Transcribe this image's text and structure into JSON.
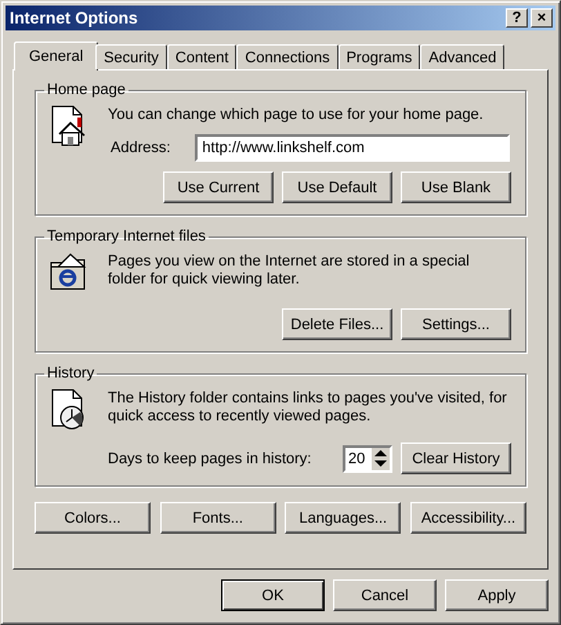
{
  "window": {
    "title": "Internet Options",
    "title_buttons": [
      "?",
      "×"
    ]
  },
  "tabs": [
    {
      "label": "General",
      "selected": true
    },
    {
      "label": "Security",
      "selected": false
    },
    {
      "label": "Content",
      "selected": false
    },
    {
      "label": "Connections",
      "selected": false
    },
    {
      "label": "Programs",
      "selected": false
    },
    {
      "label": "Advanced",
      "selected": false
    }
  ],
  "home_page": {
    "title": "Home page",
    "description": "You can change which page to use for your home page.",
    "address_label": "Address:",
    "address_value": "http://www.linkshelf.com",
    "buttons": [
      "Use Current",
      "Use Default",
      "Use Blank"
    ]
  },
  "temporary_files": {
    "title": "Temporary Internet files",
    "description": "Pages you view on the Internet are stored in a special folder for quick viewing later.",
    "buttons": [
      "Delete Files...",
      "Settings..."
    ]
  },
  "history": {
    "title": "History",
    "description": "The History folder contains links to pages you've visited, for quick access to recently viewed pages.",
    "days_label": "Days to keep pages in history:",
    "days_value": "20",
    "buttons": [
      "Clear History"
    ]
  },
  "bottom_buttons": [
    "Colors...",
    "Fonts...",
    "Languages...",
    "Accessibility..."
  ],
  "dialog_buttons": [
    {
      "label": "OK",
      "default": true
    },
    {
      "label": "Cancel",
      "default": false
    },
    {
      "label": "Apply",
      "default": false
    }
  ]
}
